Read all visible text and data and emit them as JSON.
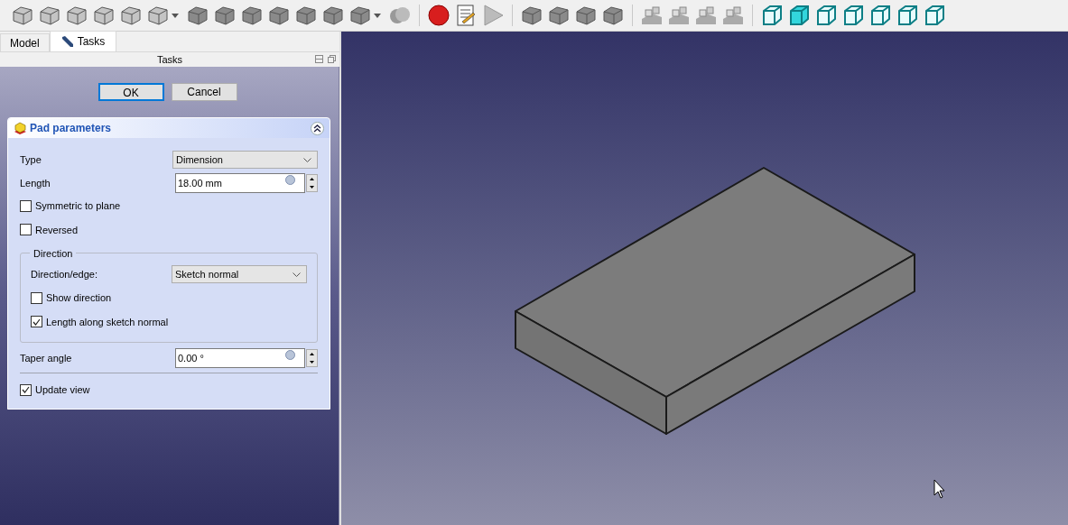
{
  "tabs": [
    {
      "label": "Model",
      "selected": false
    },
    {
      "label": "Tasks",
      "selected": true
    }
  ],
  "panel_title": "Tasks",
  "buttons": [
    {
      "label": "OK",
      "kind": "default"
    },
    {
      "label": "Cancel",
      "kind": "normal"
    }
  ],
  "pad_parameters": {
    "title": "Pad parameters",
    "expanded": true,
    "type": {
      "label": "Type",
      "value": "Dimension"
    },
    "length": {
      "label": "Length",
      "value": "18.00 mm"
    },
    "symmetric": {
      "label": "Symmetric to plane",
      "checked": false
    },
    "reversed": {
      "label": "Reversed",
      "checked": false
    },
    "direction": {
      "title": "Direction",
      "edge_label": "Direction/edge:",
      "edge_value": "Sketch normal",
      "show_direction": {
        "label": "Show direction",
        "checked": false
      },
      "length_along_normal": {
        "label": "Length along sketch normal",
        "checked": true
      }
    },
    "taper": {
      "label": "Taper angle",
      "value": "0.00 °"
    },
    "update_view": {
      "label": "Update view",
      "checked": true
    }
  }
}
